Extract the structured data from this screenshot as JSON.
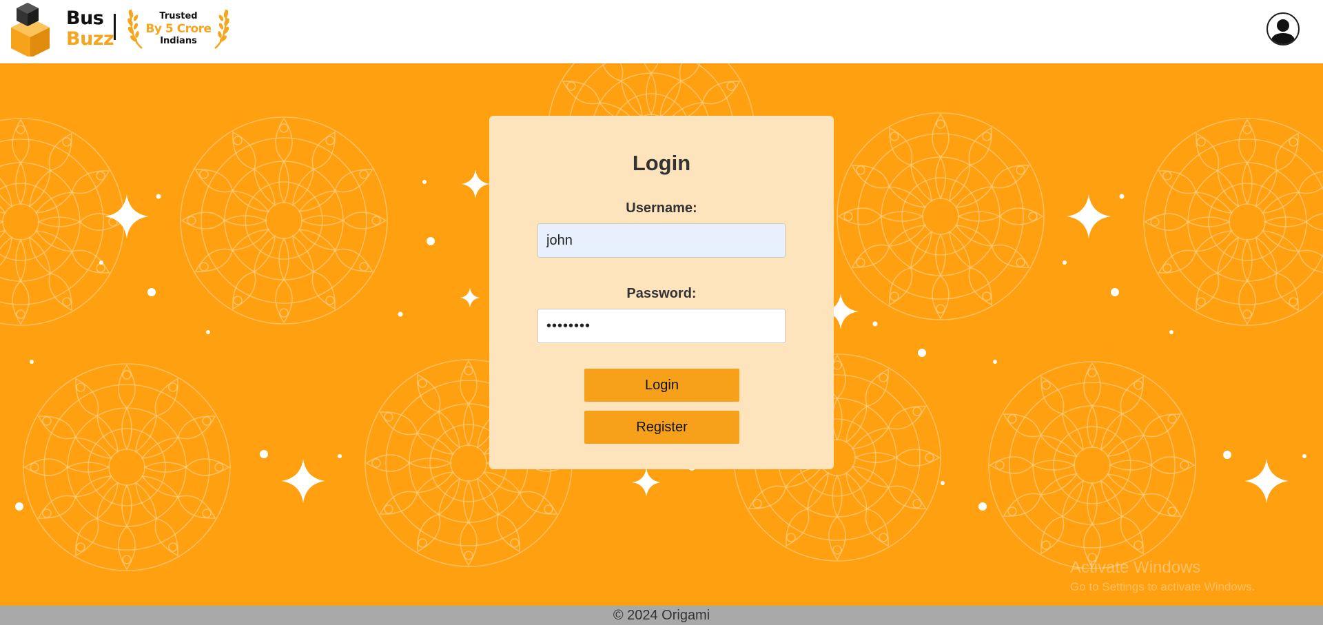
{
  "header": {
    "brand_line1": "Bus",
    "brand_line2": "Buzz",
    "trust_line1": "Trusted",
    "trust_line2": "By 5 Crore",
    "trust_line3": "Indians",
    "avatar_icon": "user-silhouette-icon"
  },
  "login": {
    "title": "Login",
    "username_label": "Username:",
    "username_value": "john",
    "password_label": "Password:",
    "password_value": "••••••••",
    "login_button": "Login",
    "register_button": "Register"
  },
  "footer": {
    "copyright": "© 2024 Origami"
  },
  "watermark": {
    "line1": "Activate Windows",
    "line2": "Go to Settings to activate Windows."
  },
  "colors": {
    "background_orange": "#ffa010",
    "card": "#fde4bd",
    "button": "#f7a11a",
    "brand_accent": "#f6a51e",
    "footer": "#a9a9a9"
  }
}
